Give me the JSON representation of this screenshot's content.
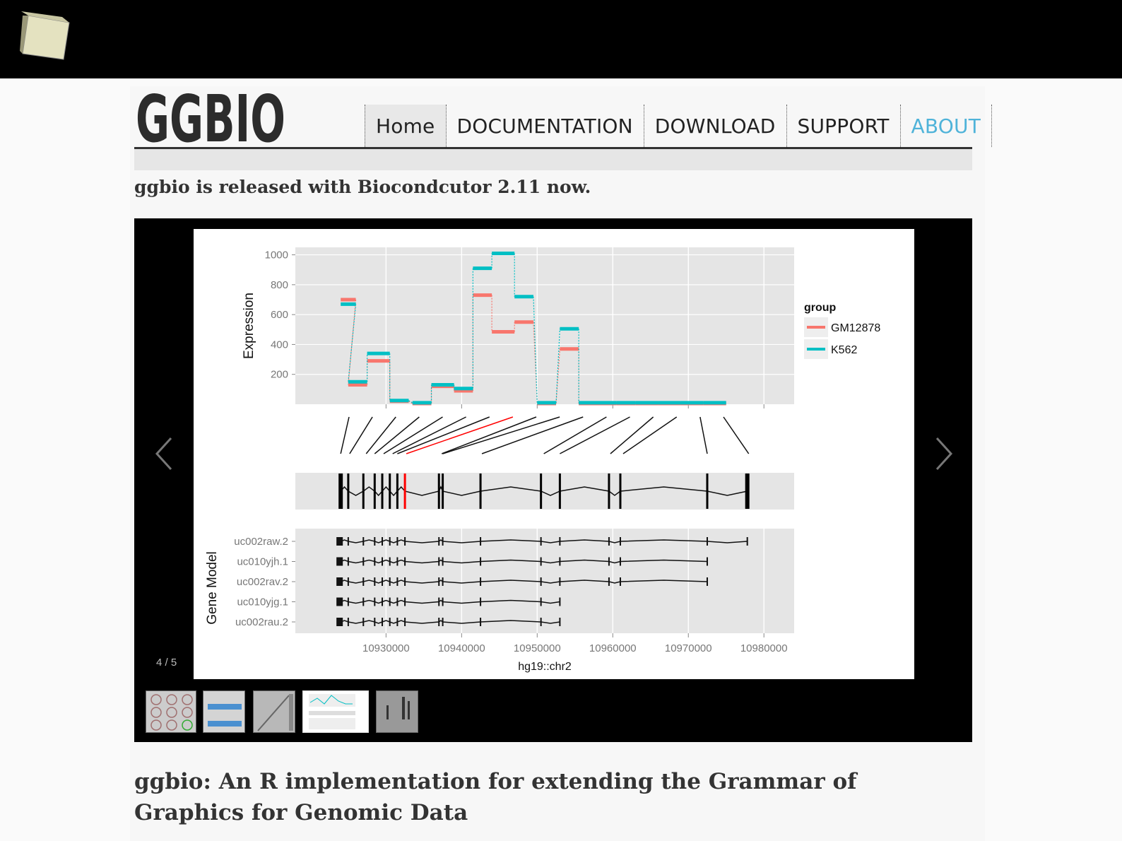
{
  "header": {
    "logo_text": "GGBIO"
  },
  "nav": {
    "items": [
      {
        "label": "Home",
        "active": true
      },
      {
        "label": "DOCUMENTATION",
        "active": false
      },
      {
        "label": "DOWNLOAD",
        "active": false
      },
      {
        "label": "SUPPORT",
        "active": false
      },
      {
        "label": "ABOUT",
        "active": false
      }
    ],
    "about_color": "#4fb3d9"
  },
  "announcement": "ggbio is released with Biocondcutor 2.11 now.",
  "slider": {
    "counter": "4 / 5",
    "prev_icon": "chevron-left-icon",
    "next_icon": "chevron-right-icon",
    "thumbnail_count": 5,
    "active_thumbnail": 4
  },
  "article_title": "ggbio: An R implementation for extending the Grammar of Graphics for Genomic Data",
  "chart_data": [
    {
      "type": "line",
      "ylabel": "Expression",
      "ylim": [
        0,
        1050
      ],
      "yticks": [
        200,
        400,
        600,
        800,
        1000
      ],
      "xlim": [
        10918000,
        10984000
      ],
      "legend": {
        "title": "group",
        "position": "right"
      },
      "series": [
        {
          "name": "GM12878",
          "color": "#f8766d",
          "segments": [
            [
              10924000,
              10926000,
              700
            ],
            [
              10925000,
              10927500,
              130
            ],
            [
              10927500,
              10930500,
              290
            ],
            [
              10930500,
              10933000,
              20
            ],
            [
              10933500,
              10936000,
              5
            ],
            [
              10936000,
              10939000,
              120
            ],
            [
              10939000,
              10941500,
              90
            ],
            [
              10941500,
              10944000,
              730
            ],
            [
              10944000,
              10947000,
              485
            ],
            [
              10947000,
              10949500,
              550
            ],
            [
              10950000,
              10952500,
              5
            ],
            [
              10953000,
              10955500,
              370
            ],
            [
              10955500,
              10960500,
              5
            ],
            [
              10960500,
              10963000,
              5
            ],
            [
              10963000,
              10966000,
              5
            ],
            [
              10966000,
              10969000,
              5
            ],
            [
              10969000,
              10972000,
              5
            ],
            [
              10972000,
              10975000,
              5
            ]
          ]
        },
        {
          "name": "K562",
          "color": "#00bfc4",
          "segments": [
            [
              10924000,
              10926000,
              670
            ],
            [
              10925000,
              10927500,
              150
            ],
            [
              10927500,
              10930500,
              340
            ],
            [
              10930500,
              10933000,
              25
            ],
            [
              10933500,
              10936000,
              10
            ],
            [
              10936000,
              10939000,
              130
            ],
            [
              10939000,
              10941500,
              105
            ],
            [
              10941500,
              10944000,
              910
            ],
            [
              10944000,
              10947000,
              1010
            ],
            [
              10947000,
              10949500,
              720
            ],
            [
              10950000,
              10952500,
              10
            ],
            [
              10953000,
              10955500,
              505
            ],
            [
              10955500,
              10960500,
              10
            ],
            [
              10960500,
              10963000,
              10
            ],
            [
              10963000,
              10966000,
              10
            ],
            [
              10966000,
              10969000,
              10
            ],
            [
              10969000,
              10972000,
              10
            ],
            [
              10972000,
              10975000,
              10
            ]
          ]
        }
      ]
    },
    {
      "type": "gene-model",
      "ylabel": "Gene Model",
      "xlabel": "hg19::chr2",
      "xlim": [
        10918000,
        10984000
      ],
      "xticks": [
        10930000,
        10940000,
        10950000,
        10960000,
        10970000,
        10980000
      ],
      "xtick_labels": [
        "10930000",
        "10940000",
        "10950000",
        "10960000",
        "10970000",
        "10980000"
      ],
      "transcripts": [
        {
          "name": "uc002raw.2",
          "start": 10924000,
          "end": 10977800
        },
        {
          "name": "uc010yjh.1",
          "start": 10924000,
          "end": 10972500
        },
        {
          "name": "uc002rav.2",
          "start": 10924000,
          "end": 10972500
        },
        {
          "name": "uc010yjg.1",
          "start": 10924000,
          "end": 10953000
        },
        {
          "name": "uc002rau.2",
          "start": 10924000,
          "end": 10953000
        }
      ],
      "exons": [
        10924000,
        10925000,
        10927000,
        10928500,
        10929500,
        10930500,
        10931500,
        10932500,
        10937000,
        10937500,
        10942500,
        10950500,
        10953000,
        10959500,
        10961000,
        10972500,
        10977800
      ],
      "highlight_exon": 10932500,
      "highlight_color": "#ff0000"
    }
  ]
}
